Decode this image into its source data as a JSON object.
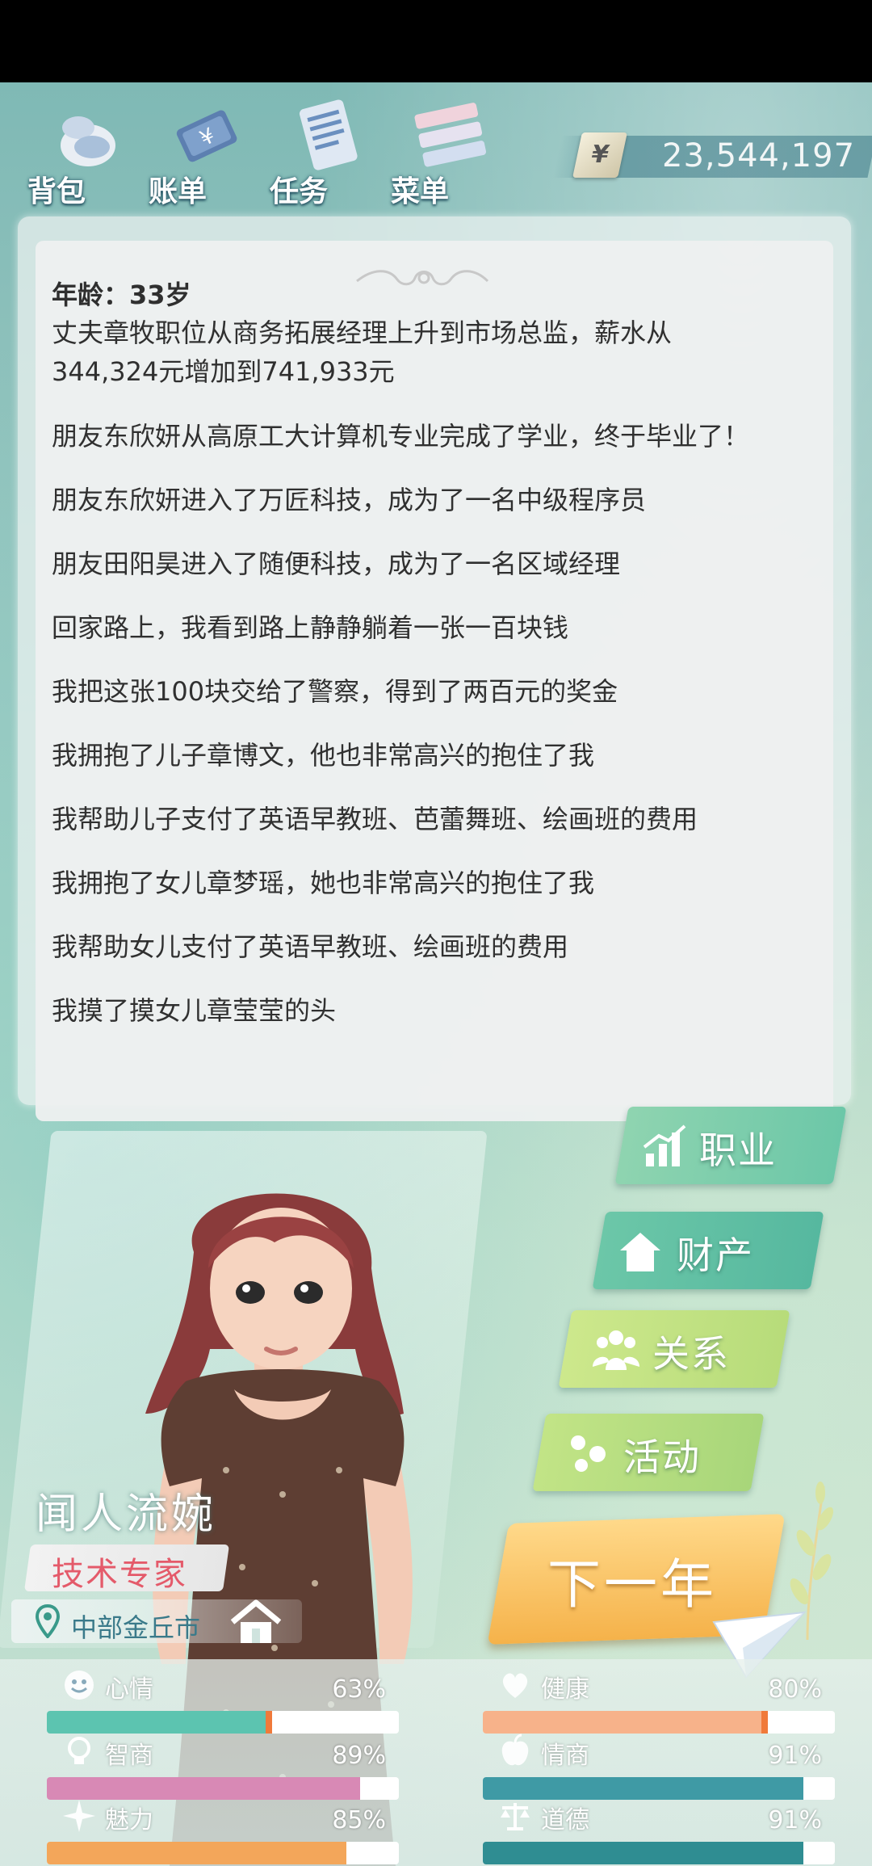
{
  "toolbar": {
    "items": [
      {
        "label": "背包",
        "icon": "bag-icon"
      },
      {
        "label": "账单",
        "icon": "bill-icon"
      },
      {
        "label": "任务",
        "icon": "task-icon"
      },
      {
        "label": "菜单",
        "icon": "menu-icon"
      }
    ],
    "money": {
      "symbol": "¥",
      "value": "23,544,197"
    }
  },
  "panel": {
    "age": "年龄：33岁",
    "events": [
      "丈夫章牧职位从商务拓展经理上升到市场总监，薪水从344,324元增加到741,933元",
      "朋友东欣妍从高原工大计算机专业完成了学业，终于毕业了！",
      "朋友东欣妍进入了万匠科技，成为了一名中级程序员",
      "朋友田阳昊进入了随便科技，成为了一名区域经理",
      "回家路上，我看到路上静静躺着一张一百块钱",
      "我把这张100块交给了警察，得到了两百元的奖金",
      "我拥抱了儿子章博文，他也非常高兴的抱住了我",
      "我帮助儿子支付了英语早教班、芭蕾舞班、绘画班的费用",
      "我拥抱了女儿章梦瑶，她也非常高兴的抱住了我",
      "我帮助女儿支付了英语早教班、绘画班的费用",
      "我摸了摸女儿章莹莹的头"
    ]
  },
  "character": {
    "name": "闻人流婉",
    "job": "技术专家",
    "location": "中部金丘市"
  },
  "side_menu": {
    "career": "职业",
    "property": "财产",
    "relations": "关系",
    "activities": "活动",
    "next_year": "下一年"
  },
  "colors": {
    "side_green": "#6cc7a8",
    "side_light_green": "#b7dc7a",
    "next_year": "#f5b24a",
    "job_text": "#e45a6a"
  },
  "stats": [
    {
      "label": "心情",
      "value": "63%",
      "level": 0.63,
      "icon": "smile-icon",
      "color": "#5cc4b0"
    },
    {
      "label": "健康",
      "value": "80%",
      "level": 0.8,
      "icon": "heart-icon",
      "color": "#f7b28a"
    },
    {
      "label": "智商",
      "value": "89%",
      "level": 0.89,
      "icon": "bulb-icon",
      "color": "#d889b5"
    },
    {
      "label": "情商",
      "value": "91%",
      "level": 0.91,
      "icon": "apple-icon",
      "color": "#3f9aa5"
    },
    {
      "label": "魅力",
      "value": "85%",
      "level": 0.85,
      "icon": "sparkle-icon",
      "color": "#f3a65a"
    },
    {
      "label": "道德",
      "value": "91%",
      "level": 0.91,
      "icon": "scale-icon",
      "color": "#2f8d92"
    }
  ]
}
